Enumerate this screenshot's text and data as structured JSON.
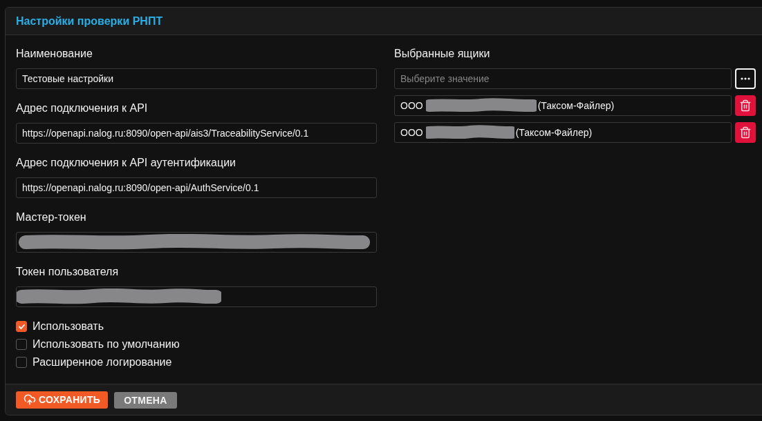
{
  "panel": {
    "title": "Настройки проверки РНПТ"
  },
  "fields": [
    {
      "label": "Наименование",
      "value": "Тестовые настройки",
      "redacted": false
    },
    {
      "label": "Адрес подключения к API",
      "value": "https://openapi.nalog.ru:8090/open-api/ais3/TraceabilityService/0.1",
      "redacted": false
    },
    {
      "label": "Адрес подключения к API аутентификации",
      "value": "https://openapi.nalog.ru:8090/open-api/AuthService/0.1",
      "redacted": false
    },
    {
      "label": "Мастер-токен",
      "redacted": true
    },
    {
      "label": "Токен пользователя",
      "redacted": true
    }
  ],
  "options": [
    {
      "label": "Использовать",
      "checked": true
    },
    {
      "label": "Использовать по умолчанию",
      "checked": false
    },
    {
      "label": "Расширенное логирование",
      "checked": false
    }
  ],
  "boxes": {
    "label": "Выбранные ящики",
    "select": {
      "placeholder": "Выберите значение"
    },
    "items": [
      {
        "prefix": "ООО",
        "suffix": "(Таксом-Файлер)",
        "redacted": true
      },
      {
        "prefix": "ООО",
        "suffix": "(Таксом-Файлер)",
        "redacted": true
      }
    ]
  },
  "buttons": [
    {
      "label": "СОХРАНИТЬ",
      "kind": "primary"
    },
    {
      "label": "ОТМЕНА",
      "kind": "secondary"
    }
  ]
}
